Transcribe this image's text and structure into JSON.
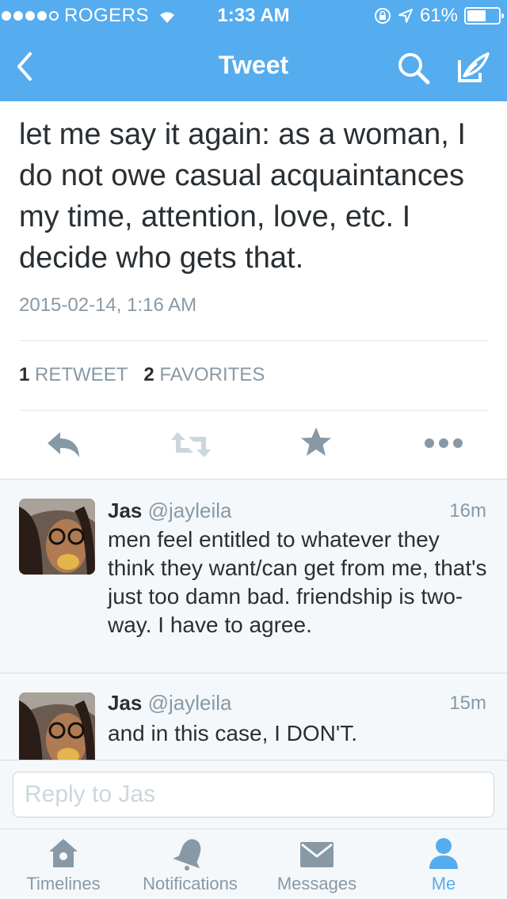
{
  "status_bar": {
    "carrier": "ROGERS",
    "time": "1:33 AM",
    "battery": "61%",
    "battery_level": 0.61
  },
  "nav": {
    "title": "Tweet",
    "icons": [
      "back-chevron-icon",
      "search-icon",
      "compose-icon"
    ]
  },
  "tweet": {
    "text": "let me say it again: as a woman, I do not owe casual acquaintances my time, attention, love, etc. I decide who gets that.",
    "date": "2015-02-14, 1:16 AM",
    "retweets_count": "1",
    "retweets_label": "RETWEET",
    "favorites_count": "2",
    "favorites_label": "FAVORITES",
    "actions": [
      "reply-icon",
      "retweet-icon",
      "favorite-icon",
      "more-icon"
    ]
  },
  "replies": [
    {
      "name": "Jas",
      "handle": "@jayleila",
      "time": "16m",
      "text": "men feel entitled to whatever they think they want/can get from me, that's just too damn bad. friendship is two-way. I have to agree."
    },
    {
      "name": "Jas",
      "handle": "@jayleila",
      "time": "15m",
      "text": "and in this case, I DON'T."
    }
  ],
  "reply_box": {
    "placeholder": "Reply to Jas"
  },
  "tabs": [
    {
      "label": "Timelines",
      "icon": "home-icon",
      "active": false
    },
    {
      "label": "Notifications",
      "icon": "bell-icon",
      "active": false
    },
    {
      "label": "Messages",
      "icon": "envelope-icon",
      "active": false
    },
    {
      "label": "Me",
      "icon": "person-icon",
      "active": true
    }
  ],
  "colors": {
    "accent": "#55acee",
    "text": "#292f33",
    "muted": "#8899a6",
    "icon_gray": "#8899a6"
  }
}
